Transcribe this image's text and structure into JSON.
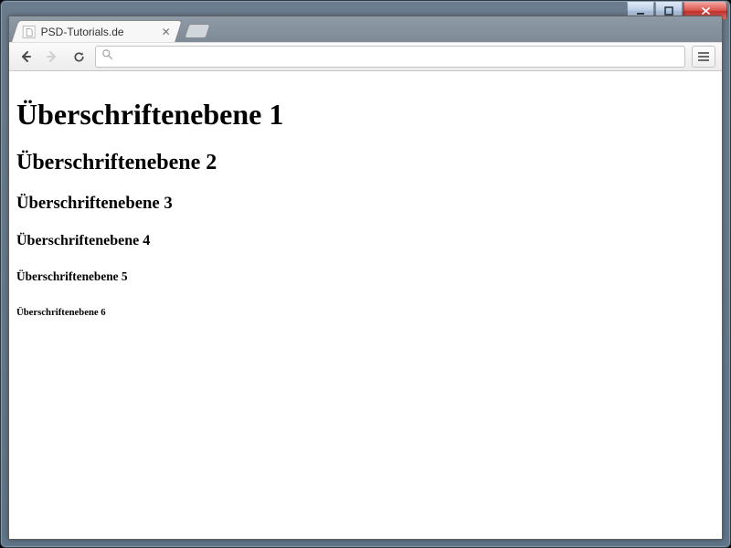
{
  "window": {
    "os": "windows-7"
  },
  "browser": {
    "name": "chrome",
    "tab": {
      "title": "PSD-Tutorials.de"
    },
    "address": {
      "value": "",
      "placeholder": ""
    }
  },
  "page": {
    "headings": {
      "h1": "Überschriftenebene 1",
      "h2": "Überschriftenebene 2",
      "h3": "Überschriftenebene 3",
      "h4": "Überschriftenebene 4",
      "h5": "Überschriftenebene 5",
      "h6": "Überschriftenebene 6"
    }
  }
}
